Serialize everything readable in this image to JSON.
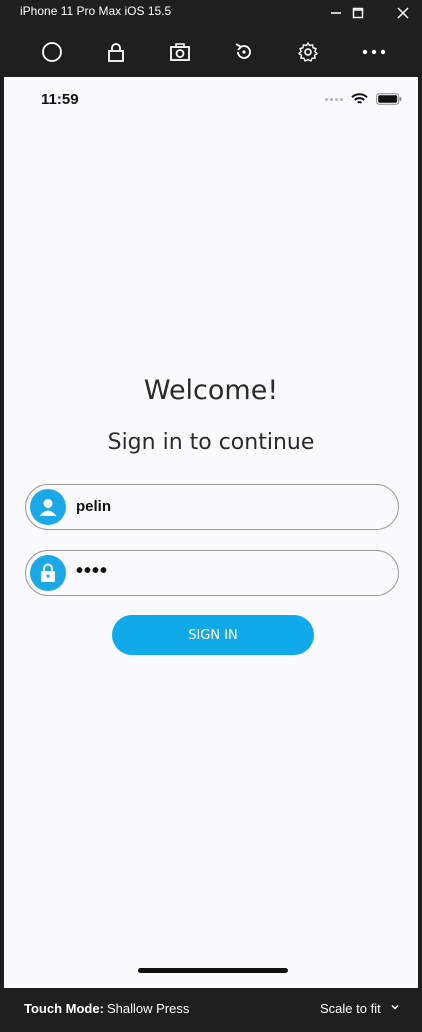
{
  "window": {
    "title": "iPhone 11 Pro Max iOS 15.5",
    "controls": [
      "minimize-icon",
      "maximize-icon",
      "close-icon"
    ]
  },
  "toolbar": {
    "tools": [
      "home-icon",
      "lock-icon",
      "camera-icon",
      "rotate-icon",
      "gear-icon",
      "more-icon"
    ]
  },
  "status_bar": {
    "time": "11:59",
    "icons": [
      "signal-dots-icon",
      "wifi-icon",
      "battery-icon"
    ]
  },
  "login": {
    "welcome": "Welcome!",
    "subtitle": "Sign in to continue",
    "username_value": "pelin",
    "password_value": "••••",
    "sign_in_label": "SIGN IN"
  },
  "bottom_bar": {
    "touch_mode_label": "Touch Mode:",
    "touch_mode_value": "Shallow Press",
    "scale_label": "Scale to fit"
  },
  "colors": {
    "accent": "#10aaea",
    "chrome": "#1f1f1f",
    "screen_bg": "#fbfbfd"
  }
}
